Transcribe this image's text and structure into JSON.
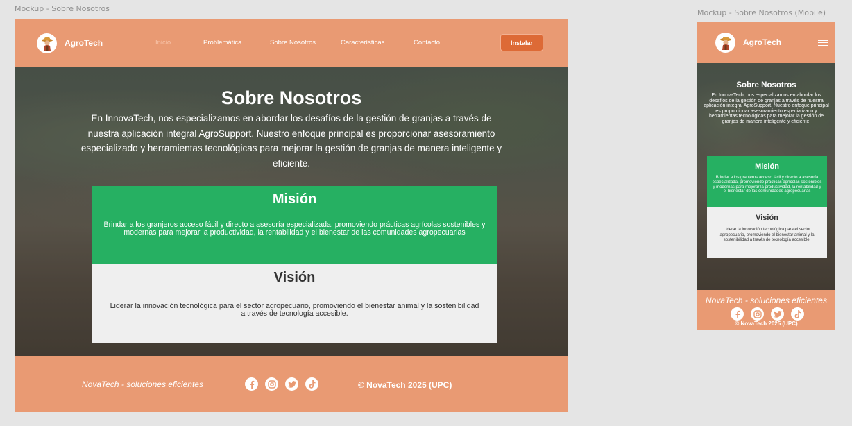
{
  "frames": {
    "desktop_label": "Mockup - Sobre Nosotros",
    "mobile_label": "Mockup - Sobre Nosotros (Mobile)"
  },
  "brand": {
    "name": "AgroTech"
  },
  "nav": {
    "links": [
      "Inicio",
      "Problemática",
      "Sobre Nosotros",
      "Características",
      "Contacto"
    ],
    "active": "Inicio",
    "install_label": "Instalar"
  },
  "hero": {
    "title": "Sobre Nosotros",
    "text": "En InnovaTech, nos especializamos en abordar los desafíos de la gestión de granjas a través de nuestra aplicación integral AgroSupport. Nuestro enfoque principal es proporcionar asesoramiento especializado y herramientas tecnológicas para mejorar la gestión de granjas de manera inteligente y eficiente."
  },
  "mision": {
    "title": "Misión",
    "text": "Brindar a los granjeros acceso fácil y directo a asesoría especializada, promoviendo prácticas agrícolas sostenibles y modernas para mejorar la productividad, la rentabilidad y el bienestar de las comunidades agropecuarias"
  },
  "vision": {
    "title": "Visión",
    "text": "Liderar la innovación tecnológica para el sector agropecuario, promoviendo el bienestar animal y la sostenibilidad a través de tecnología accesible."
  },
  "footer": {
    "slogan": "NovaTech - soluciones eficientes",
    "copyright": "© NovaTech 2025 (UPC)",
    "social": [
      "facebook-icon",
      "instagram-icon",
      "twitter-icon",
      "tiktok-icon"
    ]
  },
  "colors": {
    "header_bg": "#e99a73",
    "install_button": "#dd6a36",
    "mision_bg": "#26b062",
    "vision_bg": "#efefef"
  }
}
